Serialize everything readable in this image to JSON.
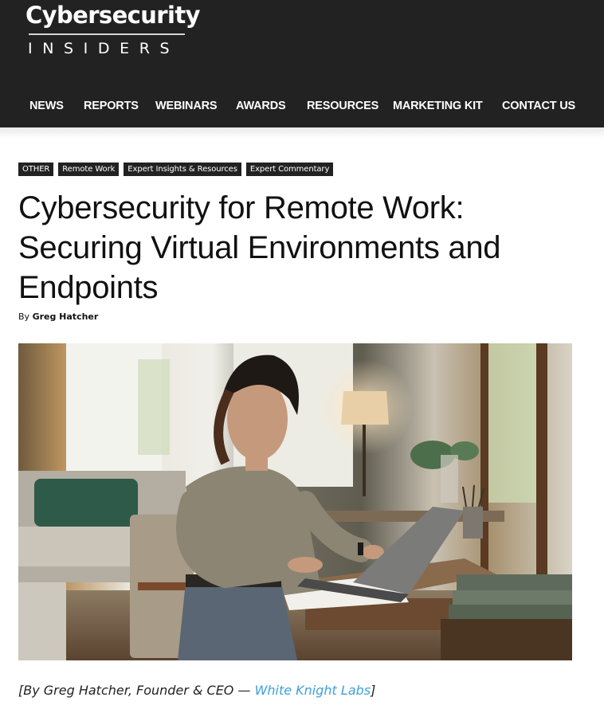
{
  "site": {
    "logo_top": "Cybersecurity",
    "logo_bottom": "INSIDERS"
  },
  "nav": {
    "items": [
      {
        "label": "NEWS"
      },
      {
        "label": "REPORTS"
      },
      {
        "label": "WEBINARS"
      },
      {
        "label": "AWARDS"
      },
      {
        "label": "RESOURCES"
      },
      {
        "label": "MARKETING KIT"
      },
      {
        "label": "CONTACT US"
      }
    ]
  },
  "article": {
    "tags": [
      {
        "label": "OTHER"
      },
      {
        "label": "Remote Work"
      },
      {
        "label": "Expert Insights & Resources"
      },
      {
        "label": "Expert Commentary"
      }
    ],
    "title": "Cybersecurity for Remote Work: Securing Virtual Environments and Endpoints",
    "byline_prefix": "By ",
    "author": "Greg Hatcher",
    "featured_image_alt": "Woman working on a laptop at a desk in a home office",
    "intro": {
      "open_bracket": "[",
      "text": "By Greg Hatcher, Founder & CEO — ",
      "link_text": "White Knight Labs",
      "close_bracket": "]"
    }
  },
  "colors": {
    "header_bg": "#222222",
    "tag_bg": "#222222",
    "link": "#3ea0dc"
  }
}
